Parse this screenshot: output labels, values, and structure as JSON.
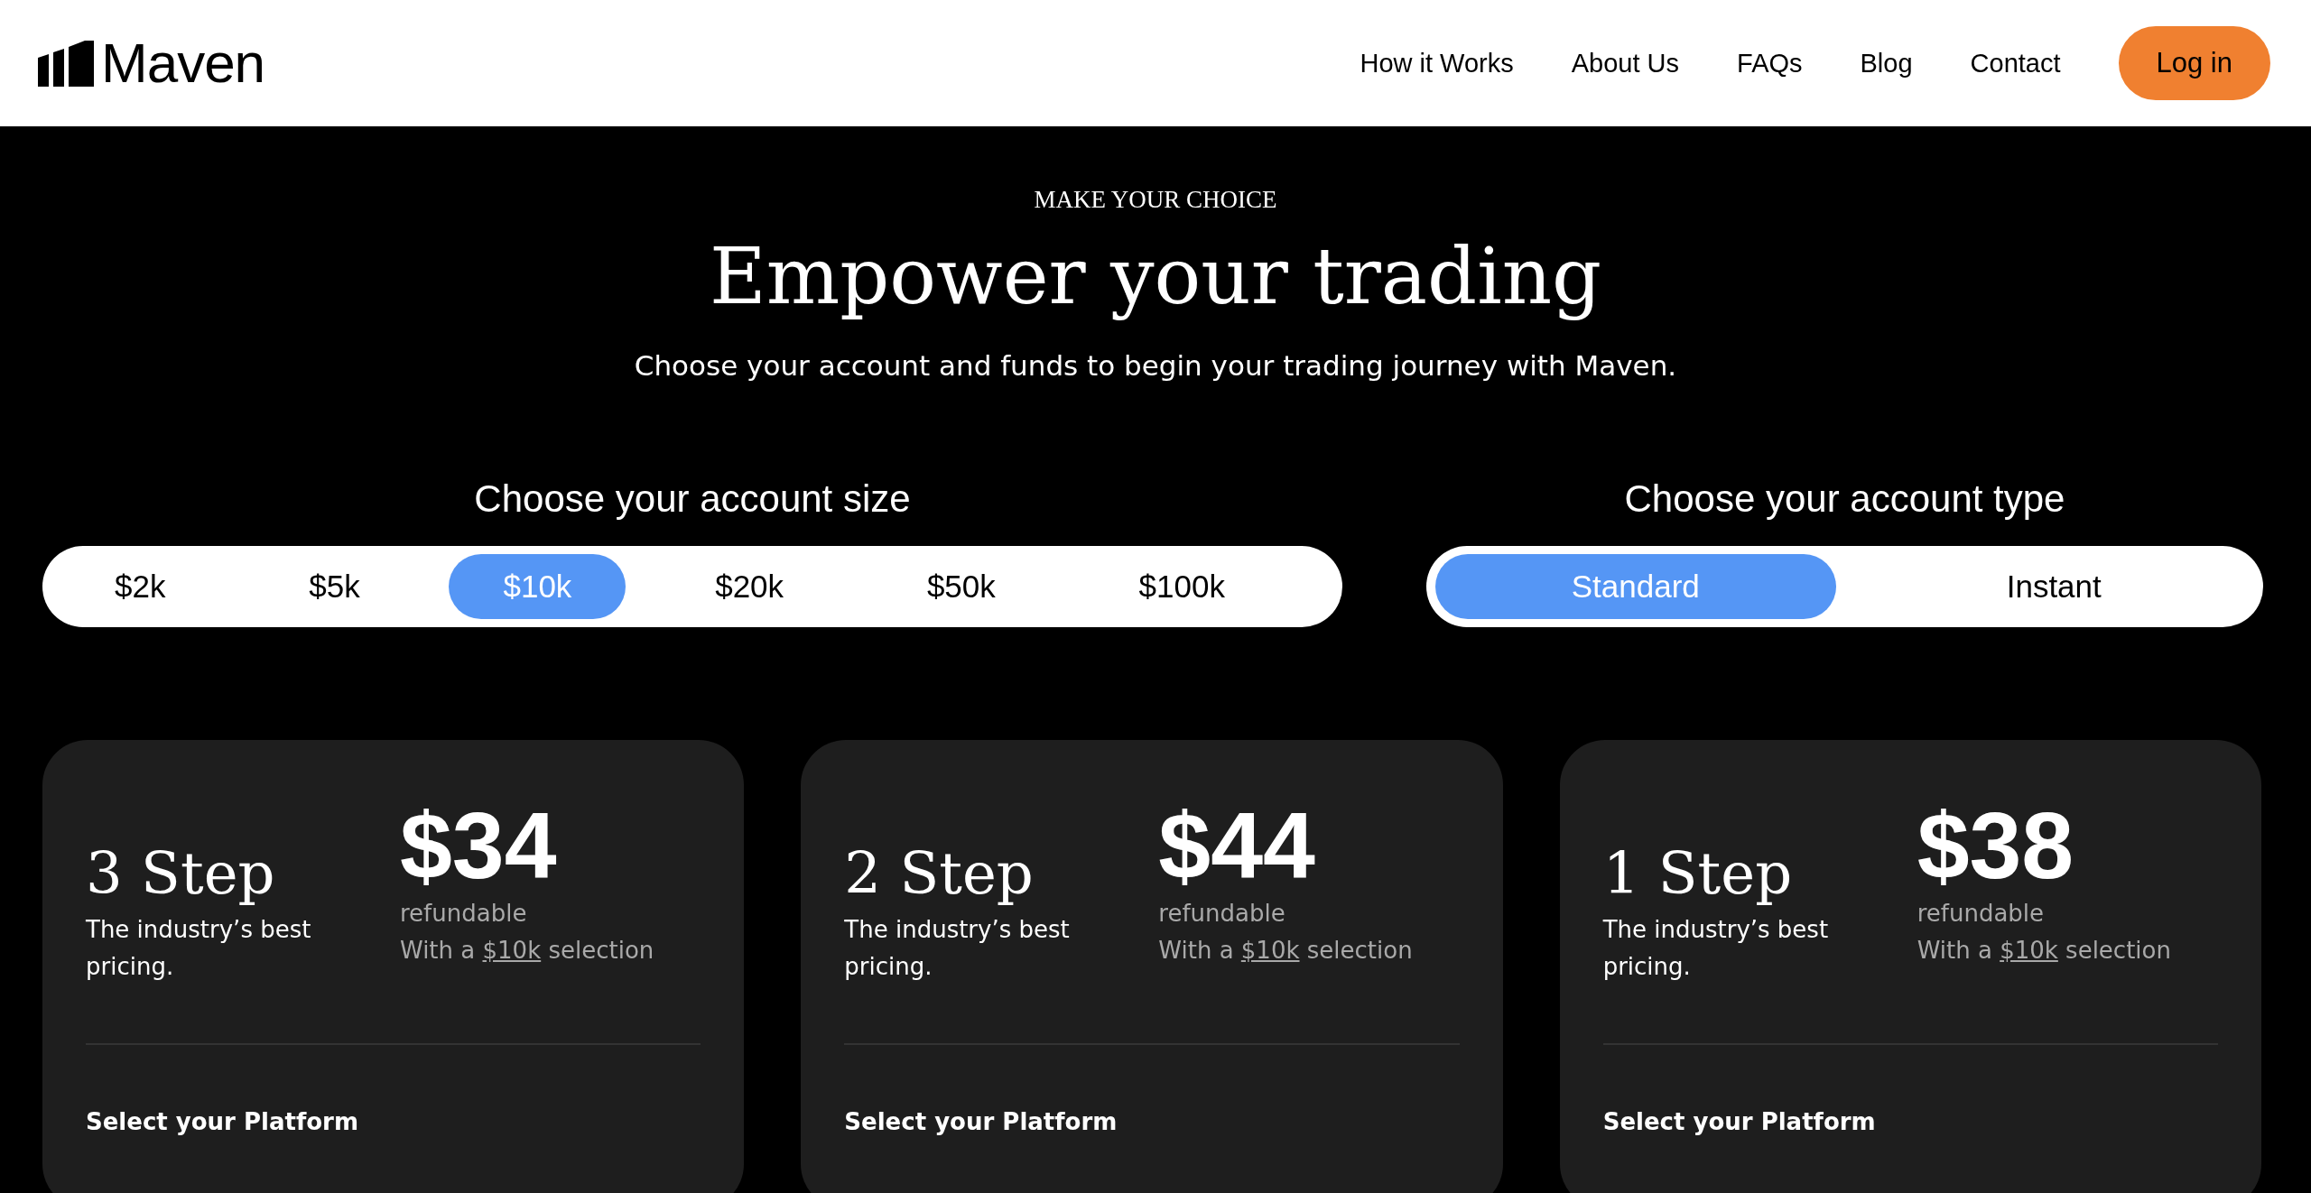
{
  "header": {
    "logo": "Maven",
    "nav": [
      "How it Works",
      "About Us",
      "FAQs",
      "Blog",
      "Contact"
    ],
    "login": "Log in"
  },
  "hero": {
    "eyebrow": "MAKE YOUR CHOICE",
    "title": "Empower your trading",
    "subtitle": "Choose your account and funds to begin your trading journey with Maven."
  },
  "account_size": {
    "heading": "Choose your account size",
    "options": [
      {
        "label": "$2k",
        "selected": false
      },
      {
        "label": "$5k",
        "selected": false
      },
      {
        "label": "$10k",
        "selected": true
      },
      {
        "label": "$20k",
        "selected": false
      },
      {
        "label": "$50k",
        "selected": false
      },
      {
        "label": "$100k",
        "selected": false
      }
    ]
  },
  "account_type": {
    "heading": "Choose your account type",
    "options": [
      {
        "label": "Standard",
        "selected": true
      },
      {
        "label": "Instant",
        "selected": false
      }
    ]
  },
  "plans": [
    {
      "name": "3 Step",
      "description": "The industry’s best pricing.",
      "price": "$34",
      "price_note": "refundable",
      "selection_prefix": "With a",
      "selection_link": "$10k",
      "selection_suffix": "selection",
      "platform_heading": "Select your Platform"
    },
    {
      "name": "2 Step",
      "description": "The industry’s best pricing.",
      "price": "$44",
      "price_note": "refundable",
      "selection_prefix": "With a",
      "selection_link": "$10k",
      "selection_suffix": "selection",
      "platform_heading": "Select your Platform"
    },
    {
      "name": "1 Step",
      "description": "The industry’s best pricing.",
      "price": "$38",
      "price_note": "refundable",
      "selection_prefix": "With a",
      "selection_link": "$10k",
      "selection_suffix": "selection",
      "platform_heading": "Select your Platform"
    }
  ]
}
